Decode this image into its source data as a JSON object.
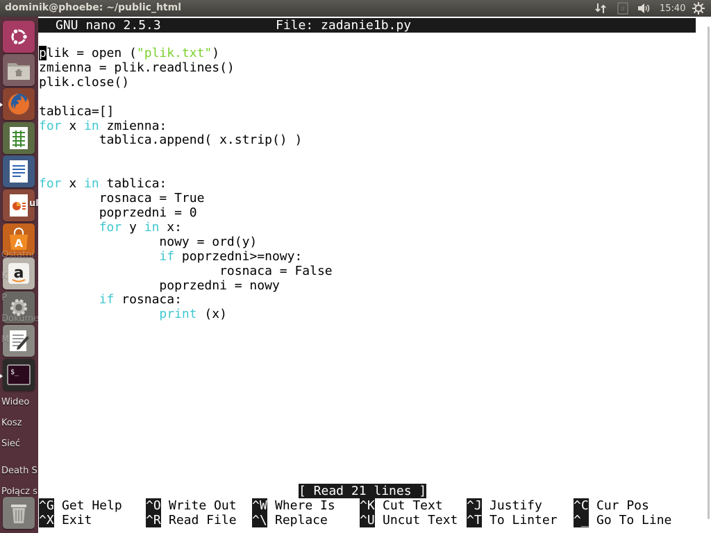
{
  "window": {
    "title": "dominik@phoebe: ~/public_html"
  },
  "tray": {
    "clock": "15:40"
  },
  "desktop_labels": [
    "ul",
    "Ostatni",
    "K",
    "P",
    "Dokume",
    "M",
    "Wideo",
    "Kosz",
    "Sieć",
    "Death S",
    "Połącz s"
  ],
  "launcher": {
    "items": [
      "dash",
      "files",
      "firefox",
      "calc",
      "writer",
      "impress",
      "software-center",
      "amazon",
      "system-settings",
      "text-editor",
      "terminal",
      "trash"
    ]
  },
  "nano": {
    "version": "GNU nano 2.5.3",
    "file_label": "File: zadanie1b.py",
    "status": "[ Read 21 lines ]"
  },
  "code_lines": [
    "plik = open (\"plik.txt\")",
    "zmienna = plik.readlines()",
    "plik.close()",
    "",
    "tablica=[]",
    "for x in zmienna:",
    "        tablica.append( x.strip() )",
    "",
    "",
    "for x in tablica:",
    "        rosnaca = True",
    "        poprzedni = 0",
    "        for y in x:",
    "                nowy = ord(y)",
    "                if poprzedni>=nowy:",
    "                        rosnaca = False",
    "                poprzedni = nowy",
    "        if rosnaca:",
    "                print (x)"
  ],
  "shortcuts": {
    "row1": [
      {
        "key": "^G",
        "label": "Get Help"
      },
      {
        "key": "^O",
        "label": "Write Out"
      },
      {
        "key": "^W",
        "label": "Where Is"
      },
      {
        "key": "^K",
        "label": "Cut Text"
      },
      {
        "key": "^J",
        "label": "Justify"
      },
      {
        "key": "^C",
        "label": "Cur Pos"
      }
    ],
    "row2": [
      {
        "key": "^X",
        "label": "Exit"
      },
      {
        "key": "^R",
        "label": "Read File"
      },
      {
        "key": "^\\",
        "label": "Replace"
      },
      {
        "key": "^U",
        "label": "Uncut Text"
      },
      {
        "key": "^T",
        "label": "To Linter"
      },
      {
        "key": "^_",
        "label": "Go To Line"
      }
    ]
  },
  "colors": {
    "keyword": "#3fc8cf",
    "string": "#7bd12f",
    "launcher_bg": "#55313c",
    "header_bg": "#1a1a1a"
  }
}
